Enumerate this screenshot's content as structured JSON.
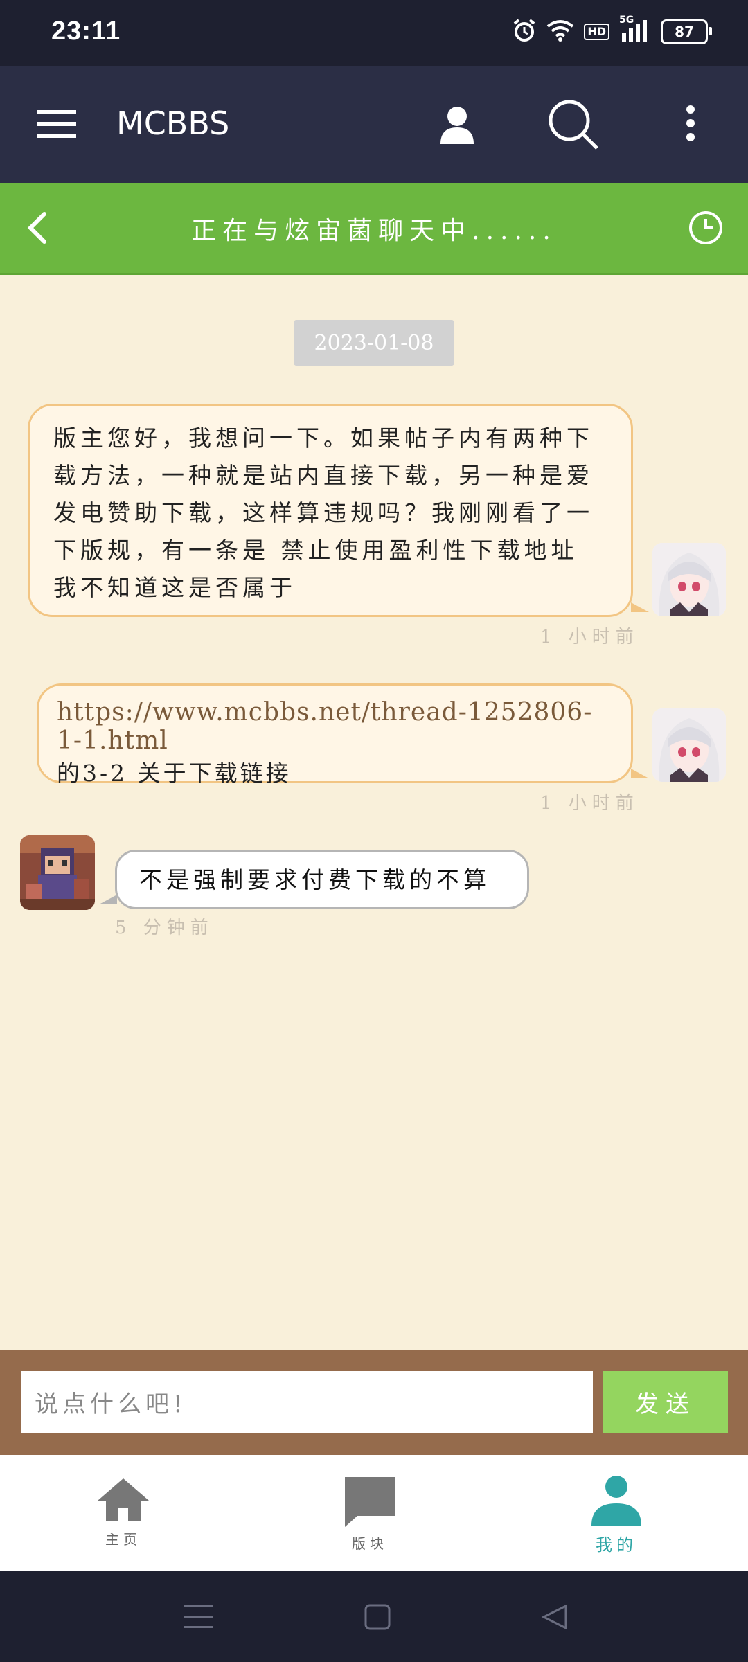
{
  "status_bar": {
    "time": "23:11",
    "battery": "87",
    "hd": "HD",
    "network": "5G"
  },
  "app_bar": {
    "title": "MCBBS",
    "menu_icon": "menu-icon",
    "user_icon": "user-icon",
    "search_icon": "search-icon",
    "more_icon": "more-vert-icon"
  },
  "chat_header": {
    "title": "正在与炫宙菌聊天中......",
    "back_icon": "back-arrow-icon",
    "history_icon": "clock-icon"
  },
  "chat": {
    "date": "2023-01-08",
    "messages": [
      {
        "side": "out",
        "text": "版主您好，我想问一下。如果帖子内有两种下载方法，一种就是站内直接下载，另一种是爱发电赞助下载，这样算违规吗？我刚刚看了一下版规，有一条是 禁止使用盈利性下载地址 我不知道这是否属于",
        "time": "1 小时前"
      },
      {
        "side": "out",
        "link": "https://www.mcbbs.net/thread-1252806-1-1.html",
        "text": "的3-2 关于下载链接",
        "time": "1 小时前"
      },
      {
        "side": "in",
        "text": "不是强制要求付费下载的不算",
        "time": "5 分钟前"
      }
    ]
  },
  "input": {
    "placeholder": "说点什么吧!",
    "send_label": "发送"
  },
  "bottom_nav": {
    "items": [
      {
        "label": "主页",
        "icon": "home-icon",
        "active": false
      },
      {
        "label": "版块",
        "icon": "chat-icon",
        "active": false
      },
      {
        "label": "我的",
        "icon": "person-icon",
        "active": true
      }
    ]
  },
  "colors": {
    "header_green": "#6cb740",
    "app_bar": "#2b2e45",
    "chat_bg": "#f9f0da",
    "send_green": "#94d55f",
    "input_bar": "#956b4c",
    "active_teal": "#2fa6a6"
  }
}
